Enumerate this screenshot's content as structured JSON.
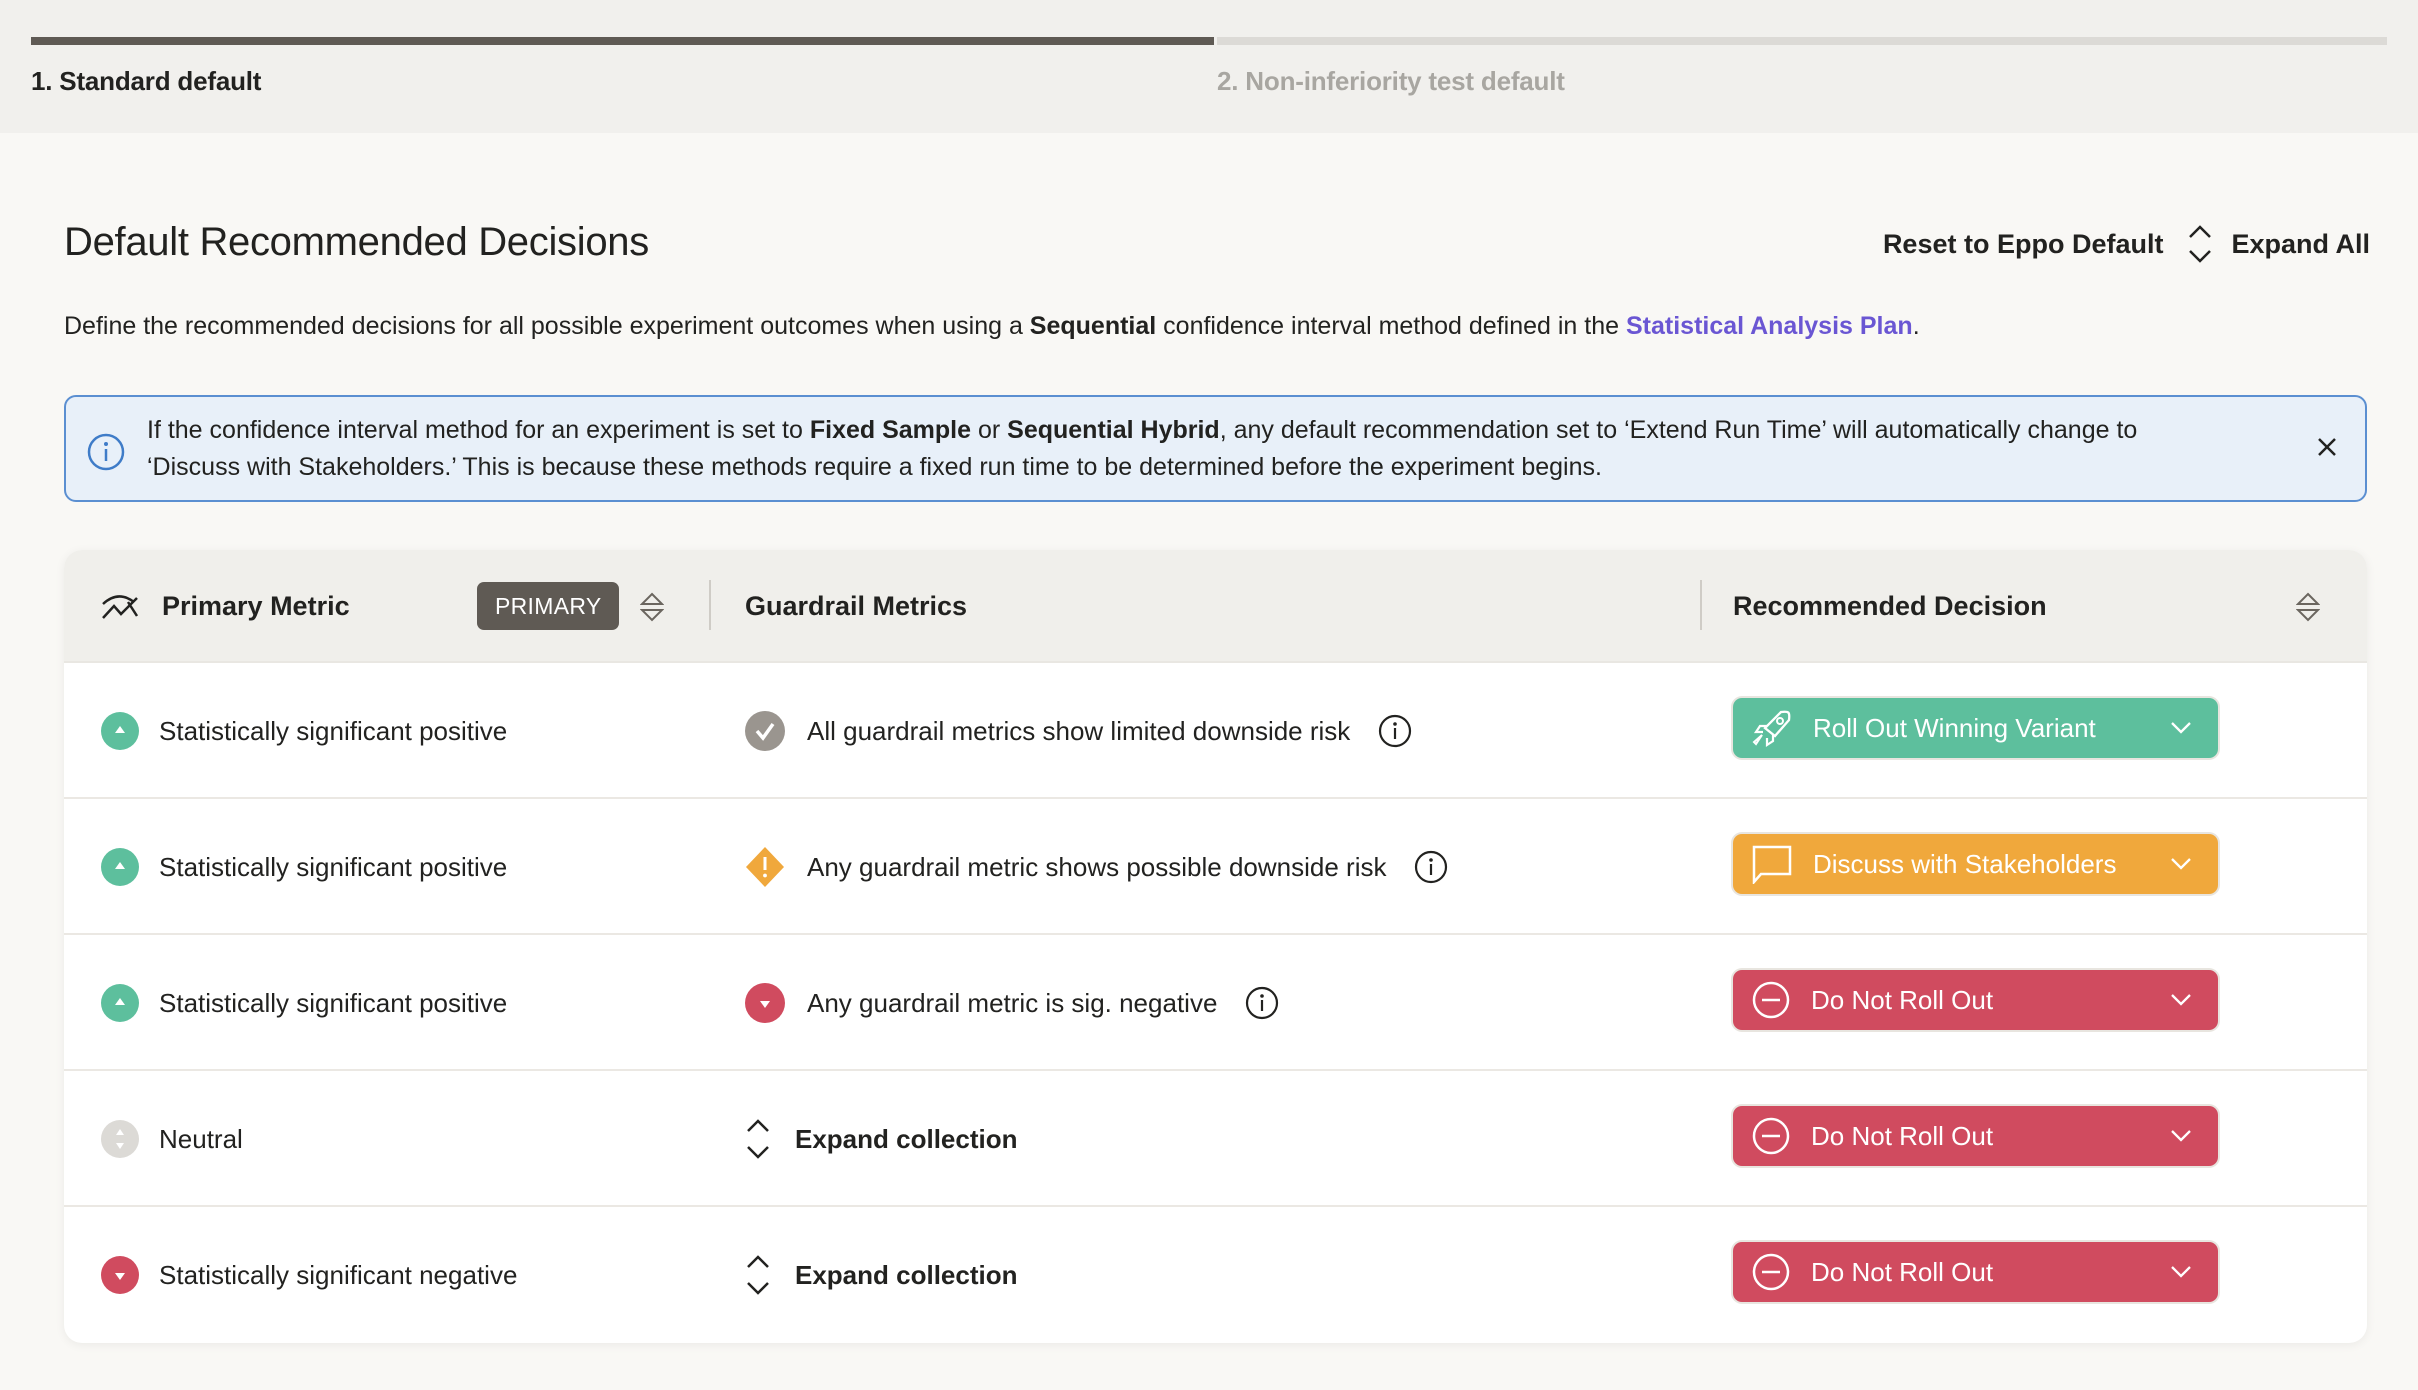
{
  "stepper": {
    "steps": [
      {
        "label": "1. Standard default",
        "active": true
      },
      {
        "label": "2. Non-inferiority test default",
        "active": false
      }
    ]
  },
  "page": {
    "title": "Default Recommended Decisions",
    "reset_label": "Reset to Eppo Default",
    "expand_all_label": "Expand All",
    "description": {
      "part1": "Define the recommended decisions for all possible experiment outcomes when using a ",
      "bold": "Sequential",
      "part2": " confidence interval method defined in the ",
      "link": "Statistical Analysis Plan",
      "part3": "."
    }
  },
  "banner": {
    "part1": "If the confidence interval method for an experiment is set to ",
    "bold1": "Fixed Sample",
    "part2": " or ",
    "bold2": "Sequential Hybrid",
    "part3": ", any default recommendation set to ‘Extend Run Time’ will automatically change to ‘Discuss with Stakeholders.’ This is because these methods require a fixed run time to be determined before the experiment begins."
  },
  "table": {
    "headers": {
      "primary": "Primary Metric",
      "primary_badge": "PRIMARY",
      "guardrail": "Guardrail Metrics",
      "decision": "Recommended Decision"
    },
    "rows": [
      {
        "primary": "Statistically significant positive",
        "primary_status": "positive",
        "guardrail": "All guardrail metrics show limited downside risk",
        "guardrail_status": "check",
        "decision": "Roll Out Winning Variant",
        "decision_type": "rollout"
      },
      {
        "primary": "Statistically significant positive",
        "primary_status": "positive",
        "guardrail": "Any guardrail metric shows possible downside risk",
        "guardrail_status": "warning",
        "decision": "Discuss with Stakeholders",
        "decision_type": "discuss"
      },
      {
        "primary": "Statistically significant positive",
        "primary_status": "positive",
        "guardrail": "Any guardrail metric is sig. negative",
        "guardrail_status": "negative",
        "decision": "Do Not Roll Out",
        "decision_type": "donot"
      },
      {
        "primary": "Neutral",
        "primary_status": "neutral",
        "guardrail": "Expand collection",
        "guardrail_status": "expand",
        "decision": "Do Not Roll Out",
        "decision_type": "donot"
      },
      {
        "primary": "Statistically significant negative",
        "primary_status": "negative",
        "guardrail": "Expand collection",
        "guardrail_status": "expand",
        "decision": "Do Not Roll Out",
        "decision_type": "donot"
      }
    ]
  },
  "colors": {
    "positive": "#5dbf9d",
    "negative": "#d04b5f",
    "neutral": "#dcdad6",
    "check": "#9a958f",
    "warning": "#f0a83c",
    "rollout": "#5dbf9d",
    "discuss": "#f0a83c",
    "donot": "#d04b5f",
    "link": "#6a56d3",
    "banner_border": "#5b8fd1",
    "banner_bg": "#e8f0f9"
  }
}
